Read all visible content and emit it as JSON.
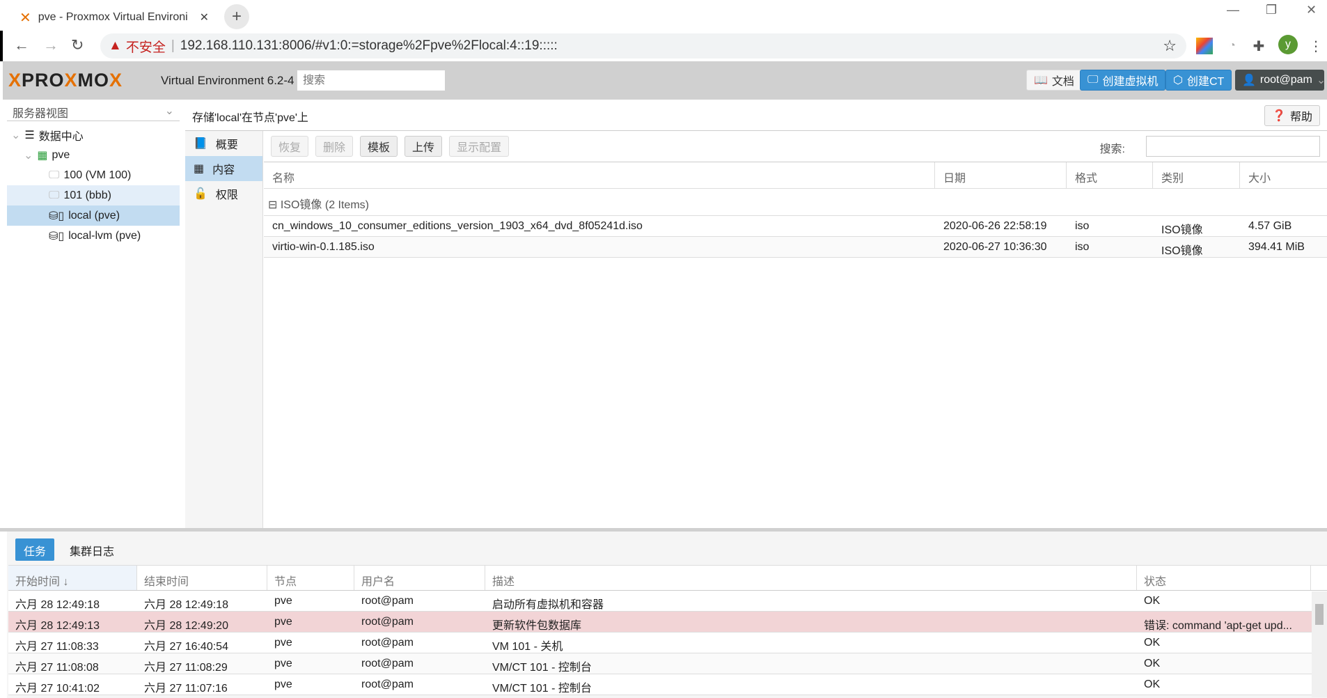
{
  "browser": {
    "tab_title": "pve - Proxmox Virtual Environi",
    "unsafe_label": "不安全",
    "url": "192.168.110.131:8006/#v1:0:=storage%2Fpve%2Flocal:4::19:::::",
    "profile_initial": "y"
  },
  "header": {
    "logo_a": "PRO",
    "logo_x": "X",
    "logo_b": "MO",
    "logo_c": "X",
    "version": "Virtual Environment 6.2-4",
    "search_placeholder": "搜索",
    "docs": "文档",
    "create_vm": "创建虚拟机",
    "create_ct": "创建CT",
    "user": "root@pam"
  },
  "sidebar": {
    "view": "服务器视图",
    "items": [
      {
        "label": "数据中心"
      },
      {
        "label": "pve"
      },
      {
        "label": "100 (VM 100)"
      },
      {
        "label": "101 (bbb)"
      },
      {
        "label": "local (pve)"
      },
      {
        "label": "local-lvm (pve)"
      }
    ]
  },
  "content": {
    "title": "存储'local'在节点'pve'上",
    "help": "帮助",
    "menu": [
      {
        "label": "概要"
      },
      {
        "label": "内容"
      },
      {
        "label": "权限"
      }
    ],
    "toolbar": {
      "restore": "恢复",
      "remove": "删除",
      "templates": "模板",
      "upload": "上传",
      "show_config": "显示配置",
      "search_label": "搜索:"
    },
    "columns": [
      "名称",
      "日期",
      "格式",
      "类别",
      "大小"
    ],
    "group": "ISO镜像 (2 Items)",
    "rows": [
      {
        "name": "cn_windows_10_consumer_editions_version_1903_x64_dvd_8f05241d.iso",
        "date": "2020-06-26 22:58:19",
        "format": "iso",
        "type": "ISO镜像",
        "size": "4.57 GiB"
      },
      {
        "name": "virtio-win-0.1.185.iso",
        "date": "2020-06-27 10:36:30",
        "format": "iso",
        "type": "ISO镜像",
        "size": "394.41 MiB"
      }
    ]
  },
  "bottom": {
    "tabs": [
      "任务",
      "集群日志"
    ],
    "columns": [
      "开始时间",
      "结束时间",
      "节点",
      "用户名",
      "描述",
      "状态"
    ],
    "rows": [
      {
        "start": "六月 28 12:49:18",
        "end": "六月 28 12:49:18",
        "node": "pve",
        "user": "root@pam",
        "desc": "启动所有虚拟机和容器",
        "status": "OK"
      },
      {
        "start": "六月 28 12:49:13",
        "end": "六月 28 12:49:20",
        "node": "pve",
        "user": "root@pam",
        "desc": "更新软件包数据库",
        "status": "错误: command 'apt-get upd..."
      },
      {
        "start": "六月 27 11:08:33",
        "end": "六月 27 16:40:54",
        "node": "pve",
        "user": "root@pam",
        "desc": "VM 101 - 关机",
        "status": "OK"
      },
      {
        "start": "六月 27 11:08:08",
        "end": "六月 27 11:08:29",
        "node": "pve",
        "user": "root@pam",
        "desc": "VM/CT 101 - 控制台",
        "status": "OK"
      },
      {
        "start": "六月 27 10:41:02",
        "end": "六月 27 11:07:16",
        "node": "pve",
        "user": "root@pam",
        "desc": "VM/CT 101 - 控制台",
        "status": "OK"
      }
    ]
  }
}
